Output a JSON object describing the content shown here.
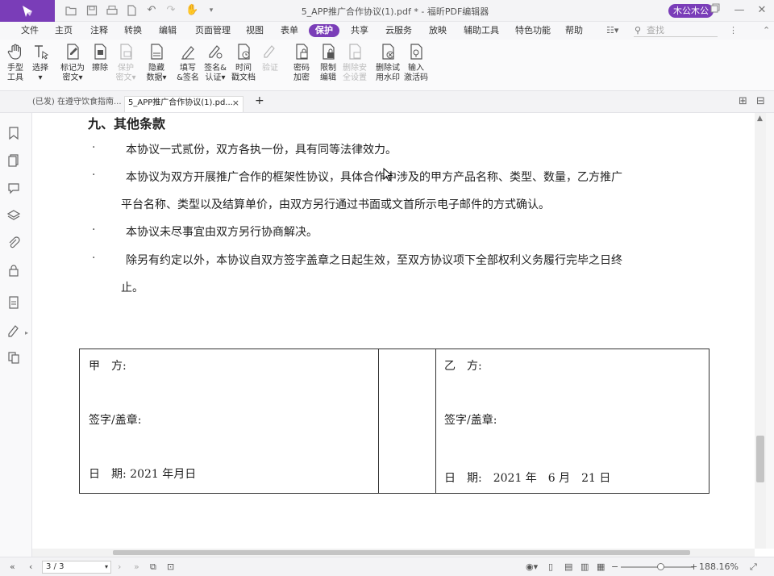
{
  "titlebar": {
    "title": "5_APP推广合作协议(1).pdf * - 福昕PDF编辑器",
    "user": "木公木公",
    "minimize": "—",
    "maximize": "☐",
    "close": "✕"
  },
  "menu": {
    "items": [
      "文件",
      "主页",
      "注释",
      "转换",
      "编辑",
      "页面管理",
      "视图",
      "表单",
      "保护",
      "共享",
      "云服务",
      "放映",
      "辅助工具",
      "特色功能",
      "帮助"
    ],
    "active": "保护",
    "search_placeholder": "查找"
  },
  "ribbon": {
    "tools": [
      {
        "label1": "手型",
        "label2": "工具",
        "icon": "hand-icon",
        "enabled": true
      },
      {
        "label1": "选择",
        "label2": "▾",
        "icon": "select-text-icon",
        "enabled": true
      },
      {
        "label1": "标记为",
        "label2": "密文▾",
        "icon": "mark-redaction-icon",
        "enabled": true
      },
      {
        "label1": "擦除",
        "label2": "",
        "icon": "erase-icon",
        "enabled": true
      },
      {
        "label1": "保护",
        "label2": "密文▾",
        "icon": "protect-redaction-icon",
        "enabled": false
      },
      {
        "label1": "隐藏",
        "label2": "数据▾",
        "icon": "hide-data-icon",
        "enabled": true
      },
      {
        "label1": "填写",
        "label2": "&签名",
        "icon": "fill-sign-icon",
        "enabled": true
      },
      {
        "label1": "签名&",
        "label2": "认证▾",
        "icon": "sign-certify-icon",
        "enabled": true
      },
      {
        "label1": "时间",
        "label2": "戳文档",
        "icon": "timestamp-icon",
        "enabled": true
      },
      {
        "label1": "验证",
        "label2": "",
        "icon": "validate-icon",
        "enabled": false
      },
      {
        "label1": "密码",
        "label2": "加密",
        "icon": "password-encrypt-icon",
        "enabled": true
      },
      {
        "label1": "限制",
        "label2": "编辑",
        "icon": "restrict-edit-icon",
        "enabled": true
      },
      {
        "label1": "删除安",
        "label2": "全设置",
        "icon": "remove-security-icon",
        "enabled": false
      },
      {
        "label1": "删除试",
        "label2": "用水印",
        "icon": "remove-watermark-icon",
        "enabled": true
      },
      {
        "label1": "输入",
        "label2": "激活码",
        "icon": "activation-code-icon",
        "enabled": true
      }
    ]
  },
  "tabs": [
    {
      "label": "(已发) 在遵守饮食指南...",
      "active": false
    },
    {
      "label": "5_APP推广合作协议(1).pd...",
      "active": true,
      "close": "×"
    }
  ],
  "new_tab": "+",
  "document": {
    "heading": "九、其他条款",
    "bullet_char": "·",
    "clauses": [
      [
        "本协议一式贰份，双方各执一份，具有同等法律效力。"
      ],
      [
        "本协议为双方开展推广合作的框架性协议，具体合作中涉及的甲方产品名称、类型、数量，乙方推广",
        "平台名称、类型以及结算单价，由双方另行通过书面或文首所示电子邮件的方式确认。"
      ],
      [
        "本协议未尽事宜由双方另行协商解决。"
      ],
      [
        "除另有约定以外，本协议自双方签字盖章之日起生效，至双方协议项下全部权利义务履行完毕之日终",
        "止。"
      ]
    ],
    "party_a": {
      "name": "甲　方:",
      "sign": "签字/盖章:",
      "date": "日　期: 2021 年月日"
    },
    "party_b": {
      "name": "乙　方:",
      "sign": "签字/盖章:",
      "date": "日　期:　2021 年　6 月　21 日"
    }
  },
  "status": {
    "page": "3 / 3",
    "zoom": "188.16%",
    "zoom_level": 0.55
  }
}
